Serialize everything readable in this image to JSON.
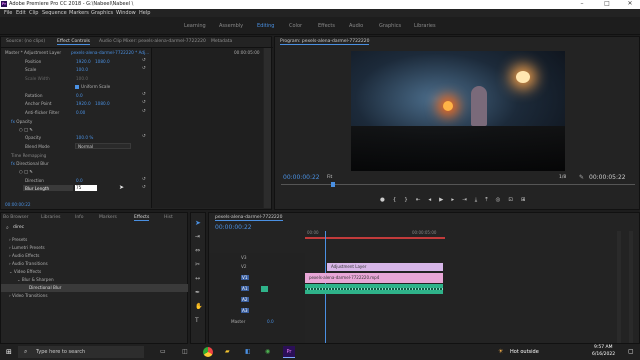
{
  "app": {
    "title": "Adobe Premiere Pro CC 2018 - G:\\Nabeel\\Nabeel \\"
  },
  "menu": [
    "File",
    "Edit",
    "Clip",
    "Sequence",
    "Markers",
    "Graphics",
    "Window",
    "Help"
  ],
  "workspaces": [
    "Learning",
    "Assembly",
    "Editing",
    "Color",
    "Effects",
    "Audio",
    "Graphics",
    "Libraries"
  ],
  "active_workspace": "Editing",
  "source_tabs": [
    "Source: (no clips)",
    "Effect Controls",
    "Audio Clip Mixer: pexels-alena-darmel-7722220",
    "Metadata"
  ],
  "effect_controls": {
    "clip_label": "Master * Adjustment Layer",
    "seq_label": "pexels-alena-darmel-7722220 * Adj...",
    "timecode_top": "00:00:05:00",
    "position": {
      "label": "Position",
      "x": "1920.0",
      "y": "1080.0"
    },
    "scale": {
      "label": "Scale",
      "v": "100.0"
    },
    "scale_width": {
      "label": "Scale Width",
      "v": "100.0"
    },
    "uniform": "Uniform Scale",
    "rotation": {
      "label": "Rotation",
      "v": "0.0"
    },
    "anchor": {
      "label": "Anchor Point",
      "x": "1920.0",
      "y": "1080.0"
    },
    "antiflicker": {
      "label": "Anti-flicker Filter",
      "v": "0.00"
    },
    "opacity": "Opacity",
    "opacity_val": {
      "label": "Opacity",
      "v": "100.0 %"
    },
    "blend": {
      "label": "Blend Mode",
      "v": "Normal"
    },
    "time_remap": "Time Remapping",
    "dir_blur": "Directional Blur",
    "direction": {
      "label": "Direction",
      "v": "0.0"
    },
    "blur_length": {
      "label": "Blur Length",
      "v": "75"
    },
    "timecode_bottom": "00:00:00:22"
  },
  "program": {
    "title": "Program: pexels-alena-darmel-7722220",
    "timecode": "00:00:00:22",
    "fit": "Fit",
    "resolution": "1/8",
    "duration": "00:00:05:22"
  },
  "project_tabs": [
    "Bo Browser",
    "Libraries",
    "Info",
    "Markers",
    "Effects",
    "Hist"
  ],
  "effects_panel": {
    "search": "direc",
    "tree": [
      "Presets",
      "Lumetri Presets",
      "Audio Effects",
      "Audio Transitions",
      "Video Effects",
      "Blur & Sharpen",
      "Directional Blur",
      "Video Transitions"
    ]
  },
  "timeline": {
    "tab": "pexels-alena-darmel-7722220",
    "timecode": "00:00:00:22",
    "ruler": [
      "00:00",
      "00:00:05:00"
    ],
    "tracks": [
      "V3",
      "V2",
      "V1",
      "A1",
      "A2",
      "A3",
      "Master"
    ],
    "master_val": "0.0",
    "clips": {
      "adjustment": "Adjustment Layer",
      "video": "pexels-alena-darmel-7722220.mp4"
    }
  },
  "taskbar": {
    "search": "Type here to search",
    "weather": "Hot outside",
    "time": "9:57 AM",
    "date": "6/16/2022"
  },
  "colors": {
    "accent": "#4a90e2",
    "adj_clip": "#d7b6e8",
    "video_clip": "#e8a6d6",
    "audio_clip": "#2fb38a"
  }
}
